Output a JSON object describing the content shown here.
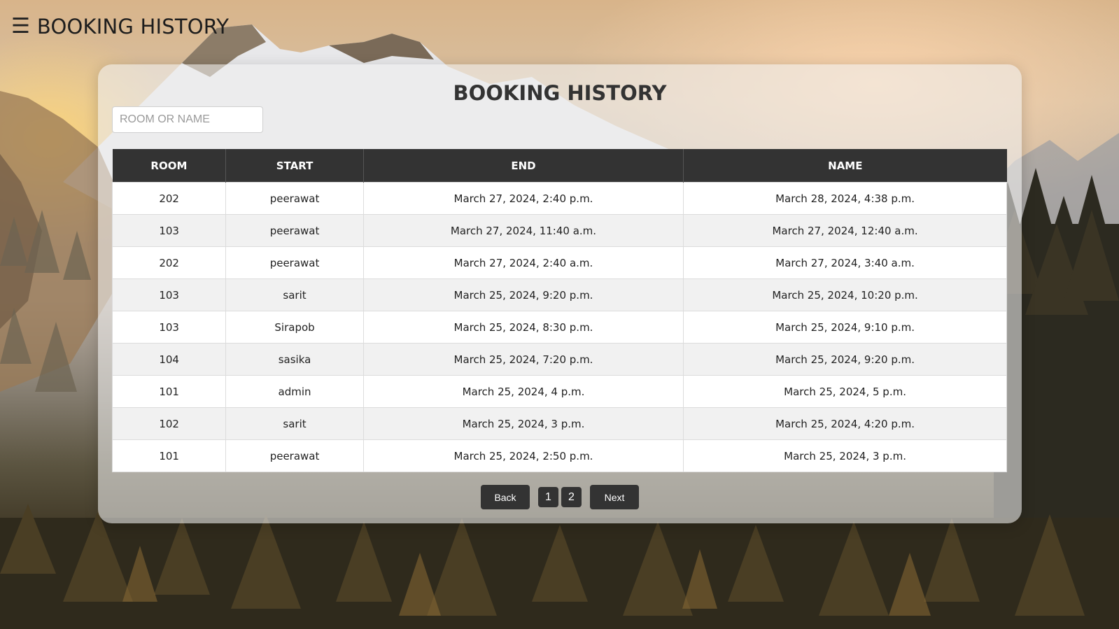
{
  "header": {
    "menu_icon": "☰",
    "title": "BOOKING HISTORY"
  },
  "card": {
    "title": "BOOKING HISTORY"
  },
  "search": {
    "placeholder": "ROOM OR NAME",
    "value": ""
  },
  "table": {
    "columns": [
      "ROOM",
      "START",
      "END",
      "NAME"
    ],
    "rows": [
      [
        "202",
        "peerawat",
        "March 27, 2024, 2:40 p.m.",
        "March 28, 2024, 4:38 p.m."
      ],
      [
        "103",
        "peerawat",
        "March 27, 2024, 11:40 a.m.",
        "March 27, 2024, 12:40 a.m."
      ],
      [
        "202",
        "peerawat",
        "March 27, 2024, 2:40 a.m.",
        "March 27, 2024, 3:40 a.m."
      ],
      [
        "103",
        "sarit",
        "March 25, 2024, 9:20 p.m.",
        "March 25, 2024, 10:20 p.m."
      ],
      [
        "103",
        "Sirapob",
        "March 25, 2024, 8:30 p.m.",
        "March 25, 2024, 9:10 p.m."
      ],
      [
        "104",
        "sasika",
        "March 25, 2024, 7:20 p.m.",
        "March 25, 2024, 9:20 p.m."
      ],
      [
        "101",
        "admin",
        "March 25, 2024, 4 p.m.",
        "March 25, 2024, 5 p.m."
      ],
      [
        "102",
        "sarit",
        "March 25, 2024, 3 p.m.",
        "March 25, 2024, 4:20 p.m."
      ],
      [
        "101",
        "peerawat",
        "March 25, 2024, 2:50 p.m.",
        "March 25, 2024, 3 p.m."
      ]
    ]
  },
  "pagination": {
    "back_label": "Back",
    "pages": [
      "1",
      "2"
    ],
    "next_label": "Next"
  },
  "colors": {
    "header_bg": "#333333",
    "button_bg": "#333333",
    "row_alt": "#f1f1f1"
  }
}
